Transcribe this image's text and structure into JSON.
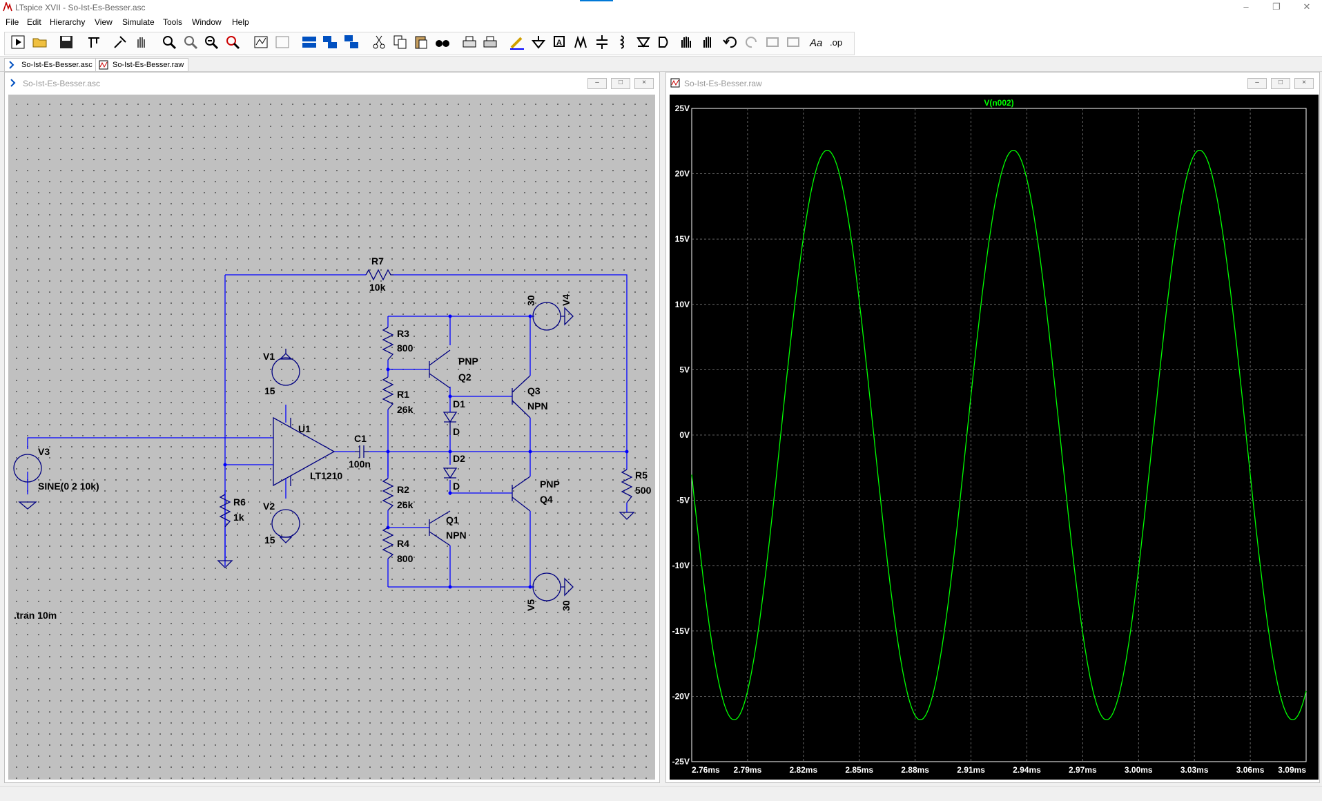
{
  "app": {
    "window_title": "LTspice XVII - So-Ist-Es-Besser.asc"
  },
  "menu": [
    "File",
    "Edit",
    "Hierarchy",
    "View",
    "Simulate",
    "Tools",
    "Window",
    "Help"
  ],
  "tabs": [
    {
      "label": "So-Ist-Es-Besser.asc",
      "icon": "schematic-icon"
    },
    {
      "label": "So-Ist-Es-Besser.raw",
      "icon": "waveform-icon"
    }
  ],
  "schematic": {
    "window_title": "So-Ist-Es-Besser.asc",
    "labels": {
      "r7": "R7",
      "r7_val": "10k",
      "v4_val": "30",
      "v4": "V4",
      "r3": "R3",
      "r3_val": "800",
      "pnp_q2": "PNP",
      "q2": "Q2",
      "v1": "V1",
      "v1_val": "15",
      "q3": "Q3",
      "npn_q3": "NPN",
      "r1": "R1",
      "r1_val": "26k",
      "d1": "D1",
      "d1_model": "D",
      "u1": "U1",
      "c1": "C1",
      "c1_val": "100n",
      "v3": "V3",
      "v3_val": "SINE(0 2 10k)",
      "op_model": "LT1210",
      "d2": "D2",
      "d2_model": "D",
      "pnp_q4": "PNP",
      "q4": "Q4",
      "r5": "R5",
      "r5_val": "500",
      "r2": "R2",
      "r2_val": "26k",
      "r6": "R6",
      "r6_val": "1k",
      "v2": "V2",
      "v2_val": "15",
      "q1": "Q1",
      "npn_q1": "NPN",
      "r4": "R4",
      "r4_val": "800",
      "v5": "V5",
      "v5_val": "30",
      "directive": ".tran 10m"
    },
    "wire_color": "#0000ff",
    "component_color": "#000080"
  },
  "waveform": {
    "window_title": "So-Ist-Es-Besser.raw",
    "trace_color": "#00ff00"
  },
  "chart_data": {
    "type": "line",
    "title": "",
    "series": [
      {
        "name": "V(n002)",
        "frequency_hz": 10000,
        "amplitude_v": 21.8,
        "phase_deg": -28
      }
    ],
    "x_range_ms": [
      2.76,
      3.09
    ],
    "x_ticks": [
      "2.76ms",
      "2.79ms",
      "2.82ms",
      "2.85ms",
      "2.88ms",
      "2.91ms",
      "2.94ms",
      "2.97ms",
      "3.00ms",
      "3.03ms",
      "3.06ms",
      "3.09ms"
    ],
    "y_range_v": [
      -25,
      25
    ],
    "y_ticks": [
      "25V",
      "20V",
      "15V",
      "10V",
      "5V",
      "0V",
      "-5V",
      "-10V",
      "-15V",
      "-20V",
      "-25V"
    ],
    "grid": true,
    "background": "#000000",
    "axis_label_color": "#ffffff"
  }
}
